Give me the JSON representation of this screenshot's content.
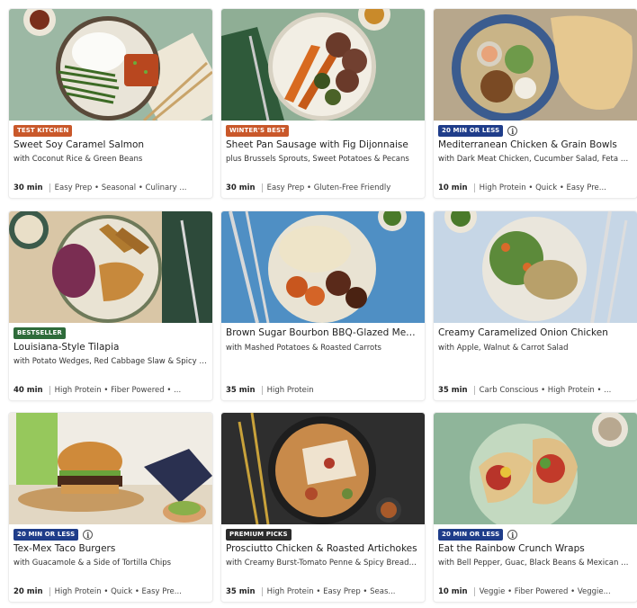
{
  "colors": {
    "badge_orange": "#c9582a",
    "badge_green": "#2e6b3a",
    "badge_blue": "#1f3d8a",
    "badge_dark": "#2b2b2b"
  },
  "recipes": [
    {
      "badge": "TEST KITCHEN",
      "badge_color": "#c9582a",
      "info_icon": false,
      "title": "Sweet Soy Caramel Salmon",
      "subtitle": "with Coconut Rice & Green Beans",
      "time": "30 min",
      "tags": "Easy Prep • Seasonal • Culinary ..."
    },
    {
      "badge": "WINTER'S BEST",
      "badge_color": "#c9582a",
      "info_icon": false,
      "title": "Sheet Pan Sausage with Fig Dijonnaise",
      "subtitle": "plus Brussels Sprouts, Sweet Potatoes & Pecans",
      "time": "30 min",
      "tags": "Easy Prep • Gluten-Free Friendly"
    },
    {
      "badge": "20 MIN OR LESS",
      "badge_color": "#1f3d8a",
      "info_icon": true,
      "title": "Mediterranean Chicken & Grain Bowls",
      "subtitle": "with Dark Meat Chicken, Cucumber Salad, Feta & R...",
      "time": "10 min",
      "tags": "High Protein • Quick • Easy Pre..."
    },
    {
      "badge": "BESTSELLER",
      "badge_color": "#2e6b3a",
      "info_icon": false,
      "title": "Louisiana-Style Tilapia",
      "subtitle": "with Potato Wedges, Red Cabbage Slaw & Spicy Re...",
      "time": "40 min",
      "tags": "High Protein • Fiber Powered • ..."
    },
    {
      "badge": "",
      "badge_color": "",
      "info_icon": false,
      "title": "Brown Sugar Bourbon BBQ-Glazed Meat...",
      "subtitle": "with Mashed Potatoes & Roasted Carrots",
      "time": "35 min",
      "tags": "High Protein"
    },
    {
      "badge": "",
      "badge_color": "",
      "info_icon": false,
      "title": "Creamy Caramelized Onion Chicken",
      "subtitle": "with Apple, Walnut & Carrot Salad",
      "time": "35 min",
      "tags": "Carb Conscious • High Protein • ..."
    },
    {
      "badge": "20 MIN OR LESS",
      "badge_color": "#1f3d8a",
      "info_icon": true,
      "title": "Tex-Mex Taco Burgers",
      "subtitle": "with Guacamole & a Side of Tortilla Chips",
      "time": "20 min",
      "tags": "High Protein • Quick • Easy Pre..."
    },
    {
      "badge": "PREMIUM PICKS",
      "badge_color": "#2b2b2b",
      "info_icon": false,
      "title": "Prosciutto Chicken & Roasted Artichokes",
      "subtitle": "with Creamy Burst-Tomato Penne & Spicy Breadcru...",
      "time": "35 min",
      "tags": "High Protein • Easy Prep • Seas..."
    },
    {
      "badge": "20 MIN OR LESS",
      "badge_color": "#1f3d8a",
      "info_icon": true,
      "title": "Eat the Rainbow Crunch Wraps",
      "subtitle": "with Bell Pepper, Guac, Black Beans & Mexican Che...",
      "time": "10 min",
      "tags": "Veggie • Fiber Powered • Veggie..."
    }
  ]
}
